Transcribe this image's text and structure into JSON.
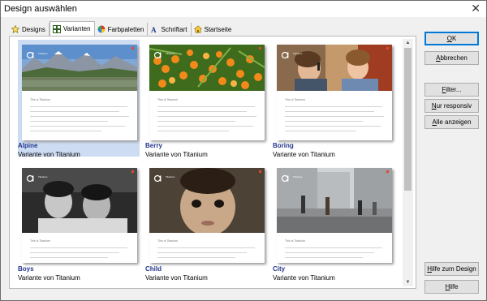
{
  "window": {
    "title": "Design auswählen",
    "close_glyph": "✕"
  },
  "tabs": [
    {
      "label": "Designs",
      "icon": "star-icon"
    },
    {
      "label": "Varianten",
      "icon": "grid-icon",
      "active": true
    },
    {
      "label": "Farbpaletten",
      "icon": "color-wheel-icon"
    },
    {
      "label": "Schriftart",
      "icon": "font-icon"
    },
    {
      "label": "Startseite",
      "icon": "home-icon"
    }
  ],
  "thumbnail": {
    "doc_title": "This is Titanium",
    "logo_text": "Titanium"
  },
  "items": [
    {
      "name": "Alpine",
      "subtitle": "Variante von Titanium",
      "selected": true
    },
    {
      "name": "Berry",
      "subtitle": "Variante von Titanium"
    },
    {
      "name": "Boring",
      "subtitle": "Variante von Titanium"
    },
    {
      "name": "Boys",
      "subtitle": "Variante von Titanium"
    },
    {
      "name": "Child",
      "subtitle": "Variante von Titanium"
    },
    {
      "name": "City",
      "subtitle": "Variante von Titanium"
    }
  ],
  "buttons": {
    "ok": {
      "label": "OK",
      "u": "O",
      "rest": "K"
    },
    "cancel": {
      "label": "Abbrechen",
      "u": "A",
      "rest": "bbrechen"
    },
    "filter": {
      "label": "Filter...",
      "u": "F",
      "rest": "ilter..."
    },
    "responsive": {
      "label": "Nur responsiv",
      "u": "N",
      "rest": "ur responsiv"
    },
    "show_all": {
      "label": "Alle anzeigen",
      "u": "A",
      "rest": "lle anzeigen"
    },
    "design_help": {
      "label": "Hilfe zum Design",
      "u": "H",
      "rest": "ilfe zum Design"
    },
    "help": {
      "label": "Hilfe",
      "u": "H",
      "rest": "ilfe"
    }
  },
  "colors": {
    "selection": "#cddcf2",
    "item_name": "#23368c",
    "accent_red": "#e04a2c"
  }
}
